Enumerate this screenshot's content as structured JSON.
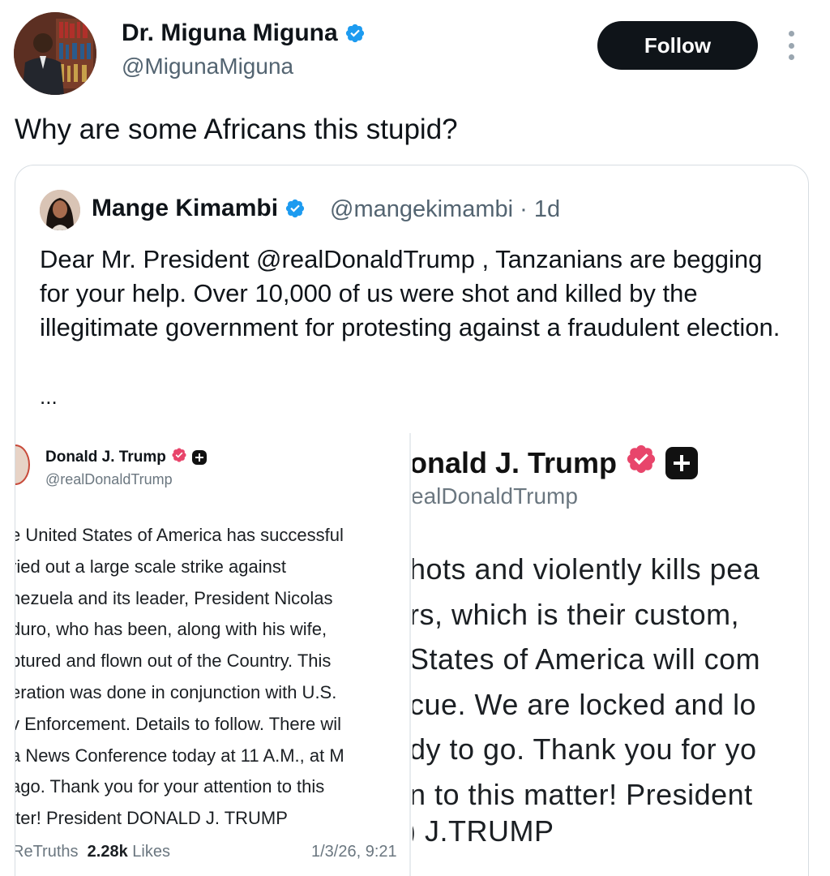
{
  "post": {
    "author_name": "Dr. Miguna Miguna",
    "author_handle": "@MigunaMiguna",
    "follow_label": "Follow",
    "text": "Why are some Africans this stupid?"
  },
  "quote": {
    "author_name": "Mange Kimambi",
    "author_handle_time": "@mangekimambi · 1d",
    "body": "Dear Mr. President @realDonaldTrump , Tanzanians are begging for your help. Over 10,000 of us were shot and killed by the illegitimate government for protesting against a fraudulent election.",
    "ellipsis": "..."
  },
  "truth_left": {
    "author_name": "Donald J. Trump",
    "author_handle": "@realDonaldTrump",
    "body": "e United States of America has successful\nried out a large scale strike against\nnezuela and its leader, President Nicolas\nduro, who has been, along with his wife,\nptured and flown out of the Country. This\neration was done in conjunction with U.S.\nv Enforcement. Details to follow. There wil\na News Conference today at 11 A.M., at M\nago. Thank you for your attention to this\ntter! President DONALD J. TRUMP",
    "retruths_label": "ReTruths",
    "likes_count": "2.28k",
    "likes_label": "Likes",
    "date": "1/3/26, 9:21"
  },
  "truth_right": {
    "author_name": "onald J. Trump",
    "author_handle": "ealDonaldTrump",
    "body": "hots and violently kills pea\nrs, which is their custom,\nStates of America will com\ncue. We are locked and lo\ndy to go. Thank you for yo\nn to this matter! President",
    "signature": ") J.TRUMP"
  },
  "colors": {
    "verified_blue": "#1d9bf0",
    "truth_badge": "#e8456b",
    "text_primary": "#0f1419",
    "text_secondary": "#536471"
  },
  "icons": [
    "verified-badge-icon",
    "more-options-icon",
    "truth-verified-icon",
    "truth-plus-icon"
  ]
}
